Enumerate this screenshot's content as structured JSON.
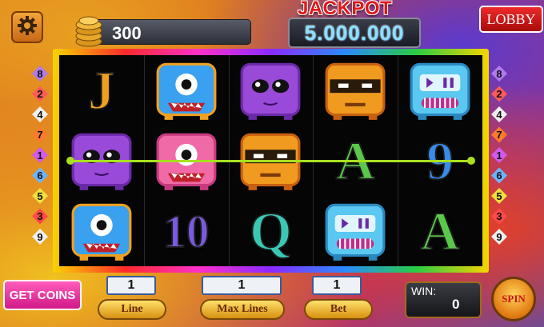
{
  "header": {
    "balance": "300",
    "jackpot_label": "JACKPOT",
    "jackpot_value": "5.000.000",
    "lobby_label": "LOBBY"
  },
  "left_lines": [
    "8",
    "2",
    "4",
    "7",
    "1",
    "6",
    "5",
    "3",
    "9"
  ],
  "right_lines": [
    "8",
    "2",
    "4",
    "7",
    "1",
    "6",
    "5",
    "3",
    "9"
  ],
  "line_colors": [
    "#b07af0",
    "#ff5a5a",
    "#f0f0f0",
    "#ff7a2a",
    "#d05af0",
    "#6ab4ff",
    "#f0e040",
    "#ff4a4a",
    "#f0f0f0"
  ],
  "reels": [
    [
      "J",
      "blue-cyclops",
      "purple-alien",
      "orange-ninja",
      "blue-robot"
    ],
    [
      "purple-alien",
      "pink-cyclops",
      "orange-ninja",
      "A",
      "9"
    ],
    [
      "blue-cyclops",
      "10",
      "Q",
      "blue-robot",
      "A"
    ]
  ],
  "controls": {
    "get_coins": "GET COINS",
    "line_value": "1",
    "line_label": "Line",
    "max_lines_value": "1",
    "max_lines_label": "Max Lines",
    "bet_value": "1",
    "bet_label": "Bet",
    "win_label": "WIN:",
    "win_value": "0",
    "spin_label": "SPIN"
  }
}
